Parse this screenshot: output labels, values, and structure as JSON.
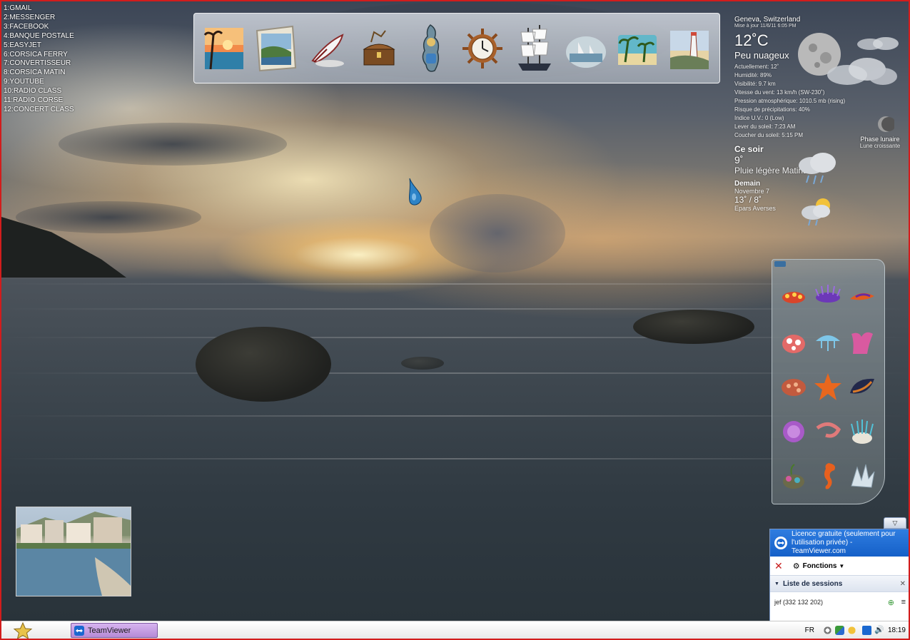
{
  "shortcuts": [
    "1:GMAIL",
    "2:MESSENGER",
    "3:FACEBOOK",
    "4:BANQUE POSTALE",
    "5:EASYJET",
    "6:CORSICA FERRY",
    "7:CONVERTISSEUR",
    "8:CORSICA MATIN",
    "9:YOUTUBE",
    "10:RADIO CLASS",
    "11:RADIO CORSE",
    "12:CONCERT CLASS"
  ],
  "dock": {
    "items": [
      "beach-sunset-painting-icon",
      "coast-painting-icon",
      "quill-pen-icon",
      "treasure-chest-icon",
      "corsica-map-icon",
      "ship-wheel-clock-icon",
      "sailing-ship-icon",
      "harbor-painting-icon",
      "tropical-beach-icon",
      "lighthouse-painting-icon"
    ]
  },
  "weather": {
    "location": "Geneva, Switzerland",
    "updated": "Mise à jour 11/6/11 6:05 PM",
    "temperature": "12˚C",
    "condition": "Peu nuageux",
    "details": [
      "Actuellement: 12˚",
      "Humidité: 89%",
      "Visibilité: 9.7 km",
      "Vitesse du vent: 13 km/h (SW-230˚)",
      "Pression atmosphérique: 1010.5 mb (rising)",
      "Risque de précipitations: 40%",
      "Indice U.V.: 0 (Low)",
      "Lever du soleil: 7:23 AM",
      "Coucher du soleil: 5:15 PM"
    ],
    "moon_phase_label": "Phase lunaire",
    "moon_phase_value": "Lune croissante",
    "tonight_label": "Ce soir",
    "tonight_temp": "9˚",
    "tonight_condition": "Pluie légère Matinal",
    "tomorrow_label": "Demain",
    "tomorrow_date": "Novembre 7",
    "tomorrow_temp": "13˚ / 8˚",
    "tomorrow_condition": "Epars Averses"
  },
  "sea_gadget": {
    "items": [
      "nudibranch-red-icon",
      "sea-slug-purple-icon",
      "nudibranch-orange-icon",
      "coral-red-icon",
      "jellyfish-blue-icon",
      "sea-sponge-pink-icon",
      "shell-coral-icon",
      "starfish-icon",
      "mussel-icon",
      "sea-urchin-icon",
      "shrimp-icon",
      "anemone-icon",
      "sea-weed-icon",
      "seahorse-icon",
      "crystal-shell-icon"
    ]
  },
  "teamviewer": {
    "banner_text": "Licence gratuite (seulement pour l'utilisation privée) - TeamViewer.com",
    "functions_label": "Fonctions",
    "sessions_label": "Liste de sessions",
    "session_entry": "jef (332 132 202)"
  },
  "taskbar": {
    "task_label": "TeamViewer",
    "language": "FR",
    "clock": "18:19"
  },
  "colors": {
    "frame_border": "#d21c1c",
    "tv_blue": "#1a68d0",
    "task_active": "#c39be0"
  }
}
